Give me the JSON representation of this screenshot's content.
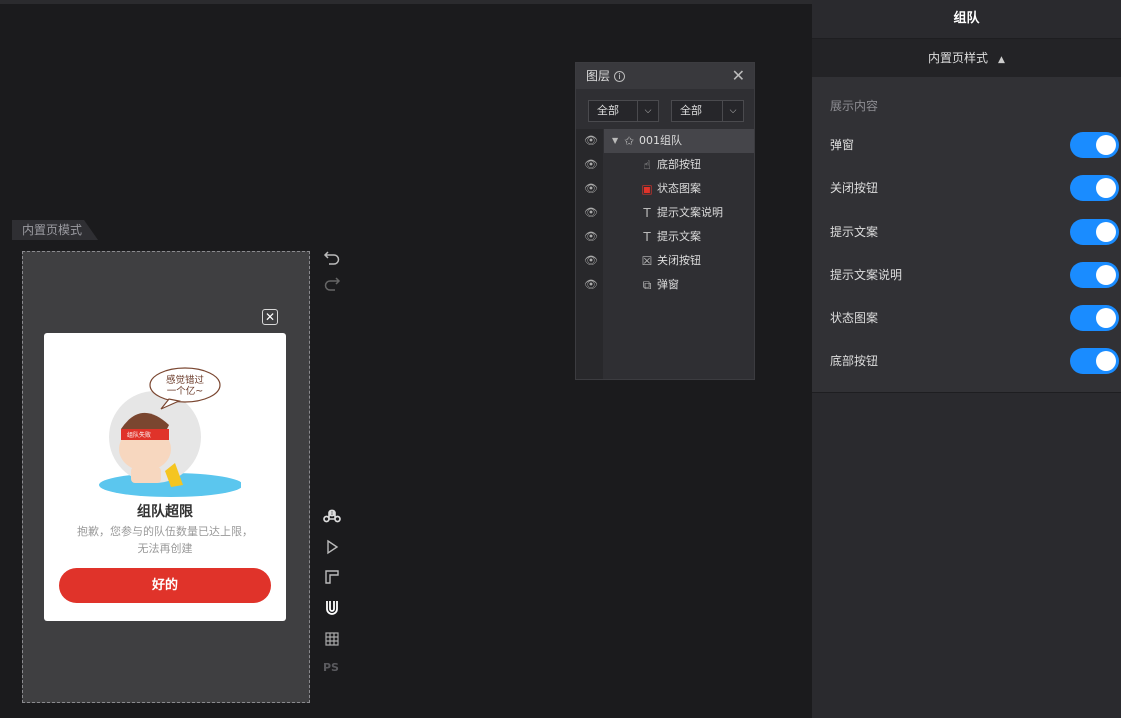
{
  "canvas": {
    "mode_tab": "内置页模式",
    "modal": {
      "close_icon": "close-icon",
      "bubble_line1": "感觉错过",
      "bubble_line2": "一个亿~",
      "headband_text": "组队失败",
      "title": "组队超限",
      "desc_line1": "抱歉，您参与的队伍数量已达上限，",
      "desc_line2": "无法再创建",
      "ok_label": "好的"
    },
    "tools": [
      "undo-icon",
      "redo-icon",
      "command-icon",
      "play-icon",
      "ruler-icon",
      "magnet-icon",
      "grid-icon"
    ],
    "ps_label": "PS"
  },
  "layers": {
    "title": "图层",
    "filter1": "全部",
    "filter2": "全部",
    "items": [
      {
        "name": "001组队",
        "icon": "component-icon",
        "active": true
      },
      {
        "name": "底部按钮",
        "icon": "hand-pointer-icon"
      },
      {
        "name": "状态图案",
        "icon": "image-icon"
      },
      {
        "name": "提示文案说明",
        "icon": "text-icon"
      },
      {
        "name": "提示文案",
        "icon": "text-icon"
      },
      {
        "name": "关闭按钮",
        "icon": "close-box-icon"
      },
      {
        "name": "弹窗",
        "icon": "layers-icon"
      }
    ]
  },
  "right_panel": {
    "title": "组队",
    "subtitle": "内置页样式",
    "section_label": "展示内容",
    "toggles": [
      {
        "label": "弹窗",
        "on": true
      },
      {
        "label": "关闭按钮",
        "on": true
      },
      {
        "label": "提示文案",
        "on": true
      },
      {
        "label": "提示文案说明",
        "on": true
      },
      {
        "label": "状态图案",
        "on": true
      },
      {
        "label": "底部按钮",
        "on": true
      }
    ],
    "accent_color": "#1a8cff"
  }
}
